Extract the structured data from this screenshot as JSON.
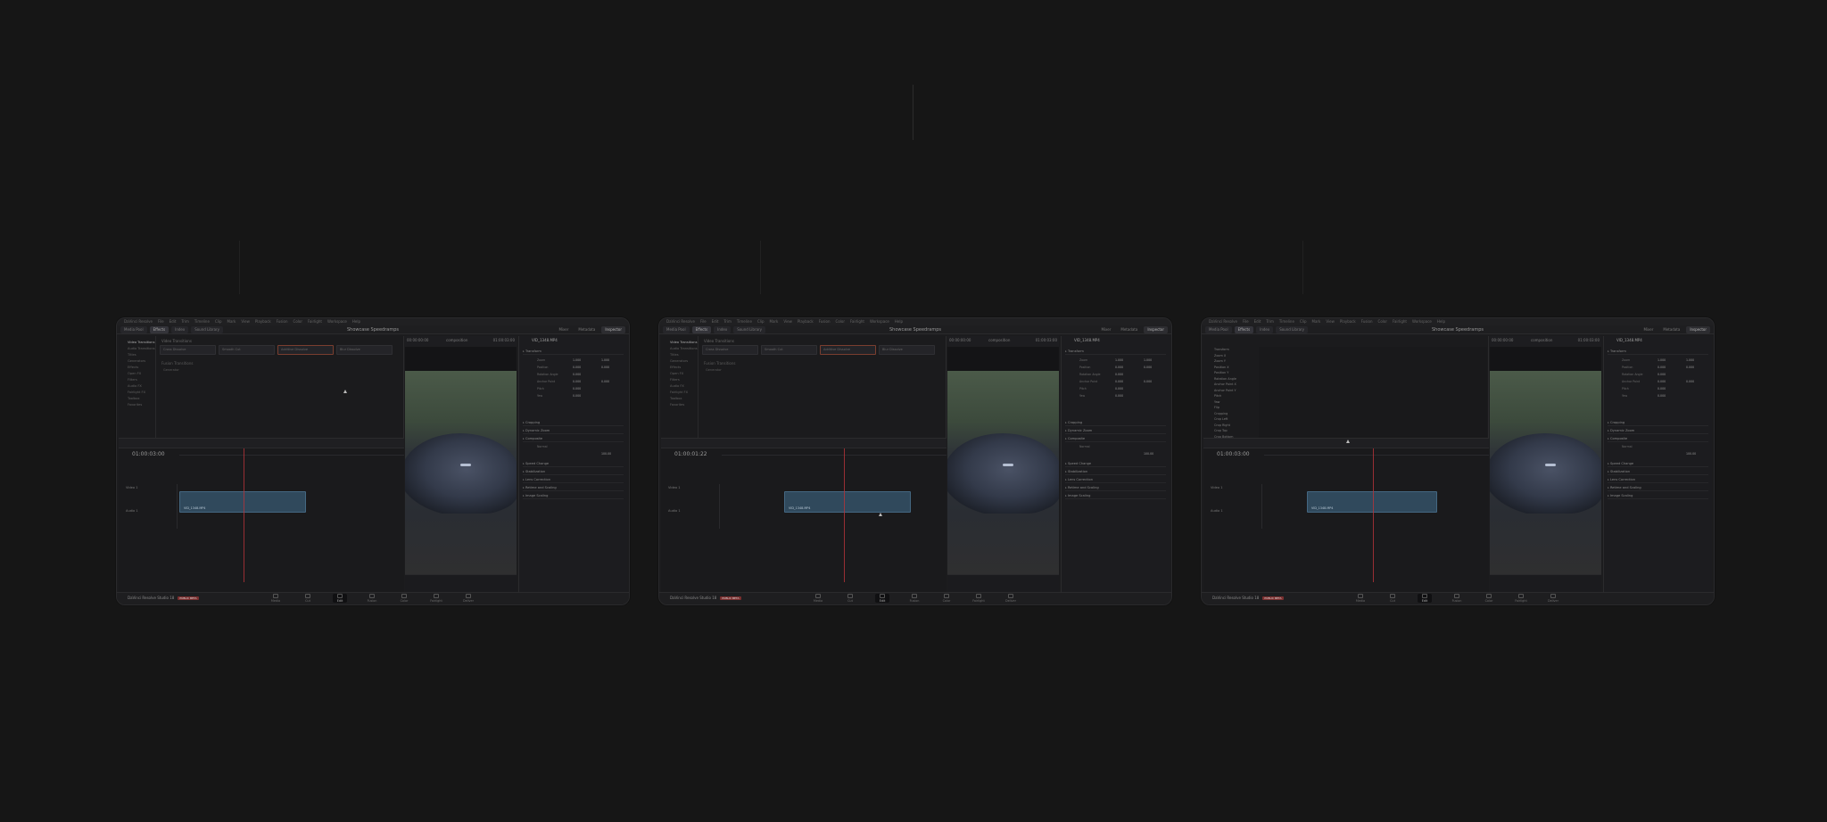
{
  "app": {
    "project_title": "Showcase Speedramps",
    "brand": "DaVinci Resolve Studio 18",
    "badge": "PUBLIC BETA",
    "menu": [
      "DaVinci Resolve",
      "File",
      "Edit",
      "Trim",
      "Timeline",
      "Clip",
      "Mark",
      "View",
      "Playback",
      "Fusion",
      "Color",
      "Fairlight",
      "Workspace",
      "Help"
    ],
    "left_tabs": [
      "Media Pool",
      "Effects",
      "Index",
      "Sound Library"
    ],
    "right_tabs": [
      "Mixer",
      "Metadata",
      "Inspector"
    ],
    "pages": [
      "Media",
      "Cut",
      "Edit",
      "Fusion",
      "Color",
      "Fairlight",
      "Deliver"
    ],
    "active_page": "Edit"
  },
  "effects": {
    "tree": [
      "Video Transitions",
      "Audio Transitions",
      "Titles",
      "Generators",
      "Effects",
      "Open FX",
      "Filters",
      "Audio FX",
      "Fairlight FX",
      "Toolbox",
      "Favorites"
    ],
    "header": "Video Transitions",
    "thumbnails": [
      "Cross Dissolve",
      "Smooth Cut",
      "Additive Dissolve",
      "Blur Dissolve"
    ],
    "section2": "Fusion Transitions",
    "generator": "Generator"
  },
  "viewer": {
    "timecode_left": "00:00:00:00",
    "name": "composition",
    "timecode_right": "01:00:03:00"
  },
  "inspector": {
    "clip_name": "VID_1348.MP4",
    "sections": [
      "Transform",
      "Cropping",
      "Dynamic Zoom",
      "Composite",
      "Speed Change",
      "Stabilization",
      "Lens Correction",
      "Retime and Scaling",
      "Image Scaling"
    ],
    "rows": [
      {
        "label": "Zoom",
        "x": "1.000",
        "y": "1.000"
      },
      {
        "label": "Position",
        "x": "0.000",
        "y": "0.000"
      },
      {
        "label": "Rotation Angle",
        "x": "0.000",
        "y": ""
      },
      {
        "label": "Anchor Point",
        "x": "0.000",
        "y": "0.000"
      },
      {
        "label": "Pitch",
        "x": "0.000",
        "y": ""
      },
      {
        "label": "Yaw",
        "x": "0.000",
        "y": ""
      }
    ],
    "composite_mode": "Normal",
    "opacity": "100.00"
  },
  "timeline": {
    "timecodes": [
      "01:00:03:00",
      "01:00:01:22",
      "01:00:03:00"
    ],
    "video_track": "Video 1",
    "audio_track": "Audio 1",
    "clip_label": "VID_1348.MP4"
  },
  "keyframes": {
    "properties": [
      "Transform",
      "Zoom X",
      "Zoom Y",
      "Position X",
      "Position Y",
      "Rotation Angle",
      "Anchor Point X",
      "Anchor Point Y",
      "Pitch",
      "Yaw",
      "Flip",
      "Cropping",
      "Crop Left",
      "Crop Right",
      "Crop Top",
      "Crop Bottom",
      "Softness",
      "Retime",
      "Opacity",
      "Composite",
      "Speed",
      "Retime Speed",
      "Retime Frame"
    ]
  }
}
